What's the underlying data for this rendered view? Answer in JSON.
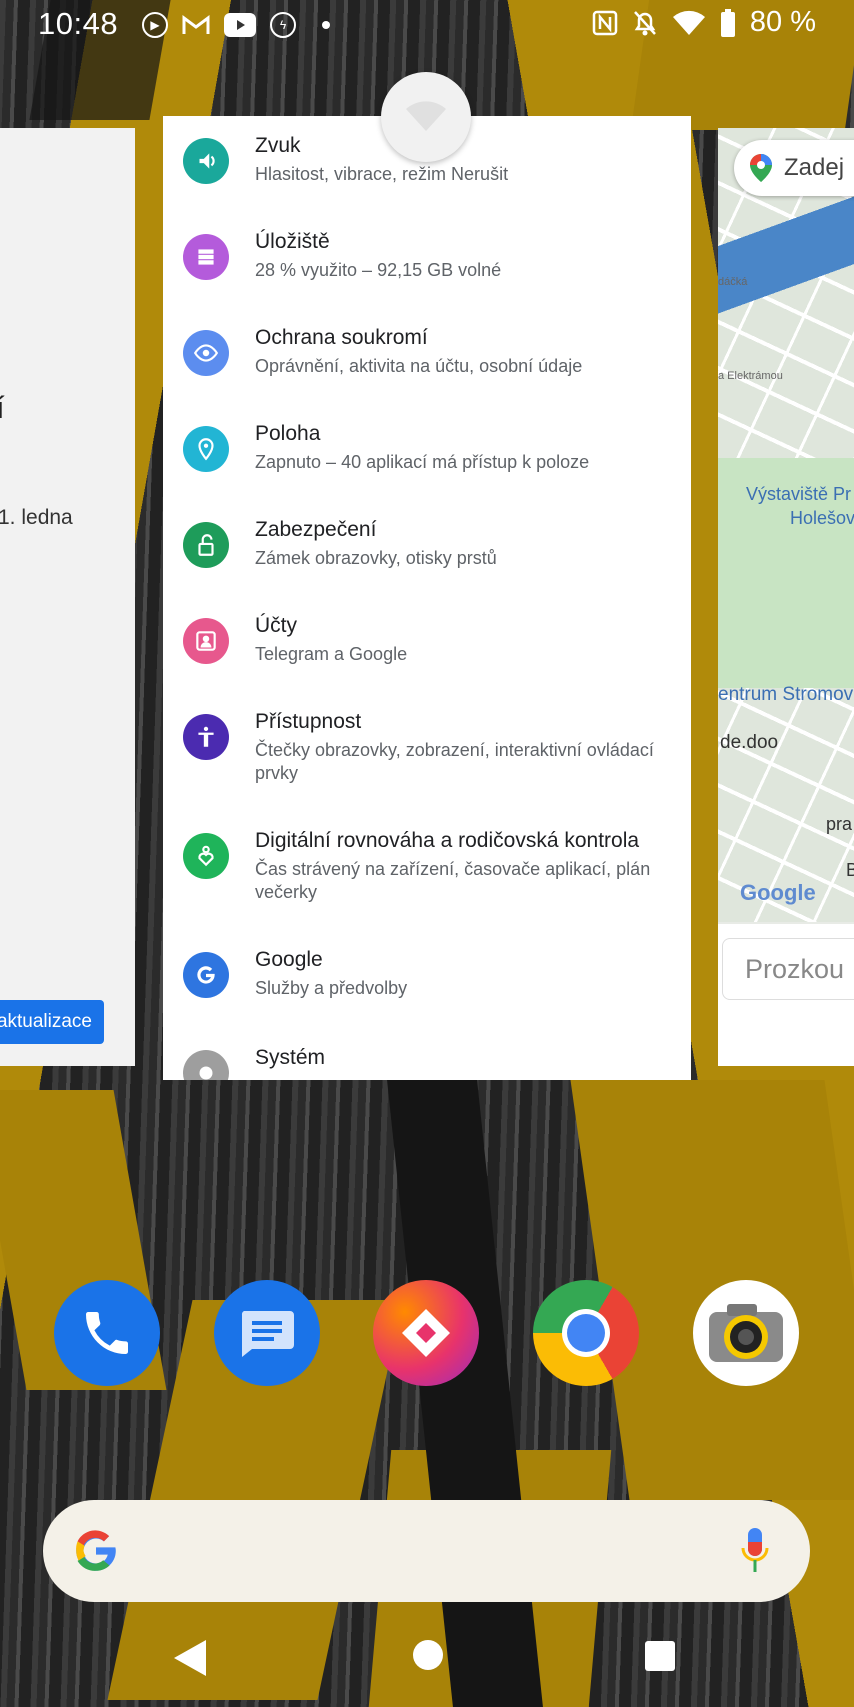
{
  "status_bar": {
    "time": "10:48",
    "battery": "80 %",
    "left_icons": [
      "play-circle-icon",
      "gmail-icon",
      "youtube-icon",
      "bolt-circle-icon",
      "dot-icon"
    ],
    "right_icons": [
      "nfc-icon",
      "bell-off-icon",
      "wifi-icon",
      "battery-icon"
    ]
  },
  "left_card": {
    "fragment_1": "í",
    "fragment_2": "1. ledna",
    "button_label": "aktualizace"
  },
  "right_card": {
    "search_text": "Zadej",
    "labels": [
      "Výstaviště Pr",
      "Holešov",
      "entrum Stromov",
      "de.doo",
      "pra",
      "B"
    ],
    "small_labels": [
      "dáčká",
      "a Elektrámou"
    ],
    "logo": "Google",
    "explore": "Prozkou"
  },
  "settings": {
    "items": [
      {
        "title": "Zvuk",
        "subtitle": "Hlasitost, vibrace, režim Nerušit",
        "icon": "volume-icon",
        "color": "#1aa89b"
      },
      {
        "title": "Úložiště",
        "subtitle": "28 % využito – 92,15 GB volné",
        "icon": "storage-icon",
        "color": "#b45bdb"
      },
      {
        "title": "Ochrana soukromí",
        "subtitle": "Oprávnění, aktivita na účtu, osobní údaje",
        "icon": "privacy-eye-icon",
        "color": "#5c8def"
      },
      {
        "title": "Poloha",
        "subtitle": "Zapnuto – 40 aplikací má přístup k poloze",
        "icon": "location-pin-icon",
        "color": "#22b5d4"
      },
      {
        "title": "Zabezpečení",
        "subtitle": "Zámek obrazovky, otisky prstů",
        "icon": "unlock-icon",
        "color": "#1e9c5a"
      },
      {
        "title": "Účty",
        "subtitle": "Telegram a Google",
        "icon": "account-box-icon",
        "color": "#e7588d"
      },
      {
        "title": "Přístupnost",
        "subtitle": "Čtečky obrazovky, zobrazení, interaktivní ovládací prvky",
        "icon": "accessibility-icon",
        "color": "#4b2bb0"
      },
      {
        "title": "Digitální rovnováha a rodičovská kontrola",
        "subtitle": "Čas strávený na zařízení, časovače aplikací, plán večerky",
        "icon": "wellbeing-heart-icon",
        "color": "#1fb45a"
      },
      {
        "title": "Google",
        "subtitle": "Služby a předvolby",
        "icon": "google-g-icon",
        "color": "#2e75e0"
      },
      {
        "title": "Systém",
        "subtitle": "",
        "icon": "system-icon",
        "color": "#9e9e9e"
      }
    ],
    "floating_icon": "wifi-icon"
  },
  "dock": {
    "apps": [
      {
        "name": "Phone",
        "icon": "phone-icon",
        "color": "#1a73e8"
      },
      {
        "name": "Messages",
        "icon": "messages-icon",
        "color": "#1a73e8"
      },
      {
        "name": "Transfer",
        "icon": "diamond-app-icon",
        "color": "#e8336b"
      },
      {
        "name": "Chrome",
        "icon": "chrome-icon",
        "color": "#4285f4"
      },
      {
        "name": "Camera",
        "icon": "camera-icon",
        "color": "#ffffff"
      }
    ]
  },
  "search": {
    "logo": "google-g-icon",
    "mic": "mic-icon"
  },
  "navbar": {
    "back": "back-icon",
    "home": "home-icon",
    "recents": "recents-icon"
  }
}
